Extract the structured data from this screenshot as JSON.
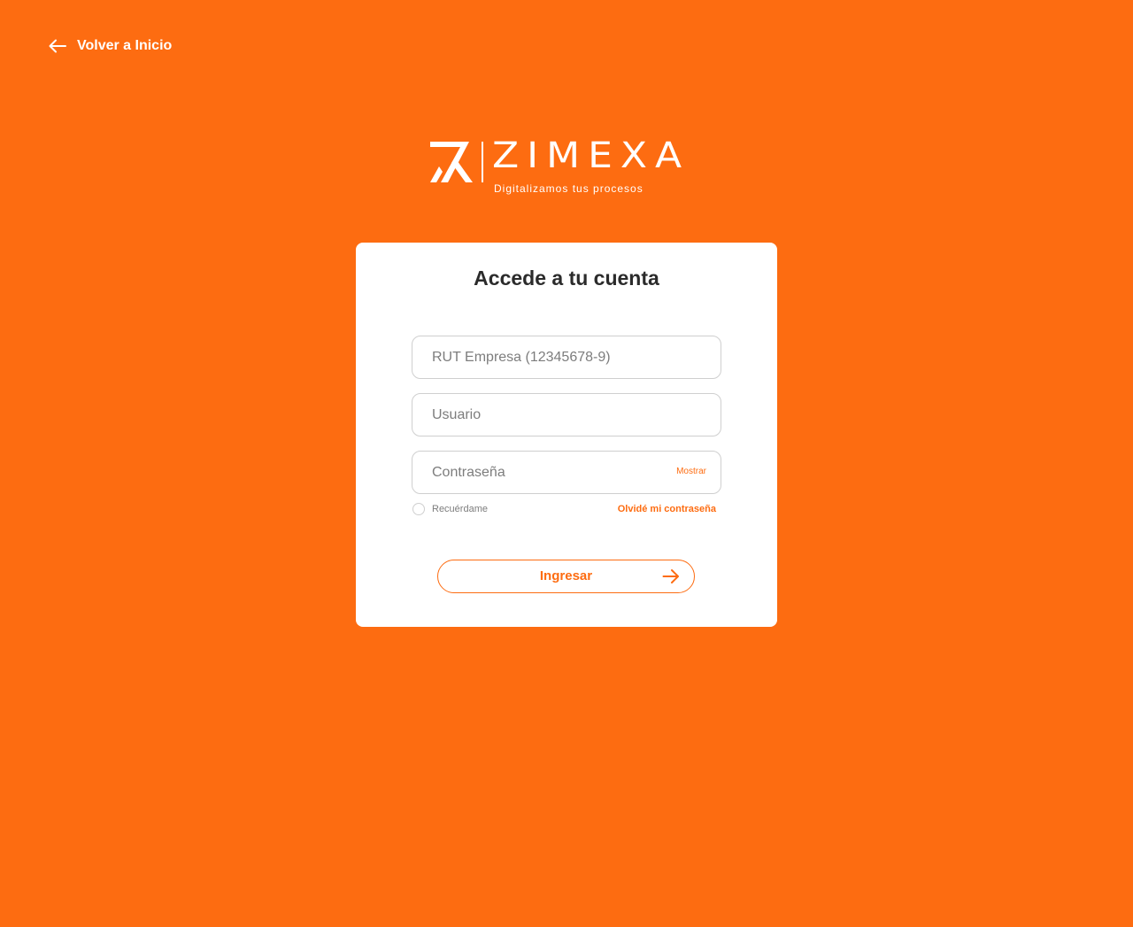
{
  "colors": {
    "background": "#fd6c11",
    "accent": "#fd6c11",
    "card": "#ffffff",
    "title": "#2b2b2b"
  },
  "nav": {
    "back_label": "Volver a Inicio",
    "back_icon": "arrow-left-icon"
  },
  "brand": {
    "name": "ZIMEXA",
    "tagline": "Digitalizamos tus procesos",
    "logo_icon": "zimexa-logo-icon"
  },
  "login": {
    "title": "Accede a tu cuenta",
    "rut_placeholder": "RUT Empresa (12345678-9)",
    "user_placeholder": "Usuario",
    "password_placeholder": "Contraseña",
    "show_password_label": "Mostrar",
    "remember_label": "Recuérdame",
    "remember_checked": false,
    "forgot_label": "Olvidé mi contraseña",
    "submit_label": "Ingresar",
    "submit_icon": "arrow-right-icon"
  }
}
